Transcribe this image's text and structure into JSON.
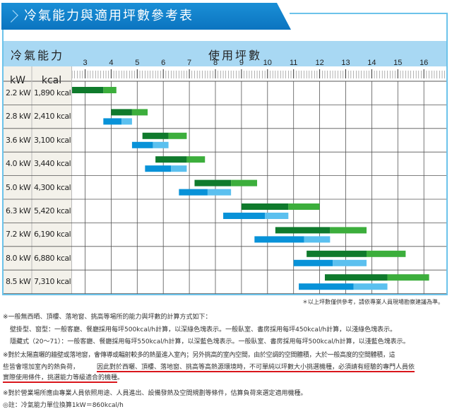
{
  "title": "冷氣能力與適用坪數參考表",
  "header": {
    "capacity": "冷氣能力",
    "area": "使用坪數",
    "kw": "kW",
    "kcal": "kcal"
  },
  "colors": {
    "green_dark": "#0f7a2c",
    "green_light": "#3cae3c",
    "blue_dark": "#0892d8",
    "blue_light": "#5bc0ef"
  },
  "chart_data": {
    "type": "bar",
    "orientation": "horizontal-range",
    "xlabel": "使用坪數",
    "xlim": [
      2.5,
      16.8
    ],
    "ticks": [
      "3",
      "4",
      "5",
      "6",
      "7",
      "8",
      "9",
      "10",
      "11",
      "12",
      "13",
      "14",
      "15",
      "16"
    ],
    "rows": [
      {
        "kw": "2.2 kW",
        "kcal": "1,890 kcal",
        "green": [
          2.5,
          3.7,
          4.2
        ],
        "blue": null
      },
      {
        "kw": "2.8 kW",
        "kcal": "2,410 kcal",
        "green": [
          4.0,
          4.8,
          5.4
        ],
        "blue": [
          3.7,
          4.4,
          4.8
        ]
      },
      {
        "kw": "3.6 kW",
        "kcal": "3,100 kcal",
        "green": [
          5.2,
          6.2,
          6.9
        ],
        "blue": [
          4.8,
          5.6,
          6.2
        ]
      },
      {
        "kw": "4.0 kW",
        "kcal": "3,440 kcal",
        "green": [
          5.7,
          6.9,
          7.6
        ],
        "blue": [
          5.3,
          6.3,
          6.9
        ]
      },
      {
        "kw": "5.0 kW",
        "kcal": "4,300 kcal",
        "green": [
          7.2,
          8.6,
          9.6
        ],
        "blue": [
          6.6,
          7.7,
          8.6
        ]
      },
      {
        "kw": "6.3 kW",
        "kcal": "5,420 kcal",
        "green": [
          9.0,
          10.8,
          12.0
        ],
        "blue": [
          8.3,
          9.9,
          10.8
        ]
      },
      {
        "kw": "7.2 kW",
        "kcal": "6,190 kcal",
        "green": [
          10.3,
          12.4,
          13.8
        ],
        "blue": [
          9.5,
          11.4,
          12.4
        ]
      },
      {
        "kw": "8.0 kW",
        "kcal": "6,880 kcal",
        "green": [
          11.5,
          13.8,
          15.3
        ],
        "blue": [
          11.0,
          12.5,
          13.8
        ]
      },
      {
        "kw": "8.5 kW",
        "kcal": "7,310 kcal",
        "green": [
          12.2,
          14.6,
          16.2
        ],
        "blue": [
          11.2,
          13.3,
          14.6
        ]
      }
    ]
  },
  "notes": {
    "ref": "＊以上坪數僅供參考，請依專業人員現場勘察建議為準。",
    "n1": "※一般無西晒、頂樓、落地窗、挑高等場所的能力與坪數的計算方式如下：",
    "n1a": "壁掛型、窗型：一般客廳、餐廳採用每坪500kcal/h計算，以深綠色塊表示。一般臥室、書房採用每坪450kcal/h計算，以淺綠色塊表示。",
    "n1b": "隱藏式（20～71）：一般客廳、餐廳採用每坪550kcal/h計算，以深藍色塊表示。一般臥室、書房採用每坪500kcal/h計算，以淺藍色塊表示。",
    "n2a": "※對於太陽直曬的牆壁或落地窗，會傳導或輻射較多的熱量進入室內；另外挑高的室內空間，由於空調的空間體積，大於一般高度的空間體積，這",
    "n2b": "些皆會增加室內的熱負荷，",
    "n2c": "因此對於西曬、頂樓、落地窗、挑高等高熱源環境時，不可單純以坪數大小挑選機種，必須請有經驗的專門人員依",
    "n2d": "實際使用條件，挑選能力等級適合的機種",
    "n2e": "。",
    "n3": "※對於營業場所應由專業人員依照用途、人員進出、設備發熱及空間規劃等條件，估算負荷來選定適用機種。",
    "n4": "◎註：冷氣能力單位換算1kW＝860kcal/h"
  }
}
